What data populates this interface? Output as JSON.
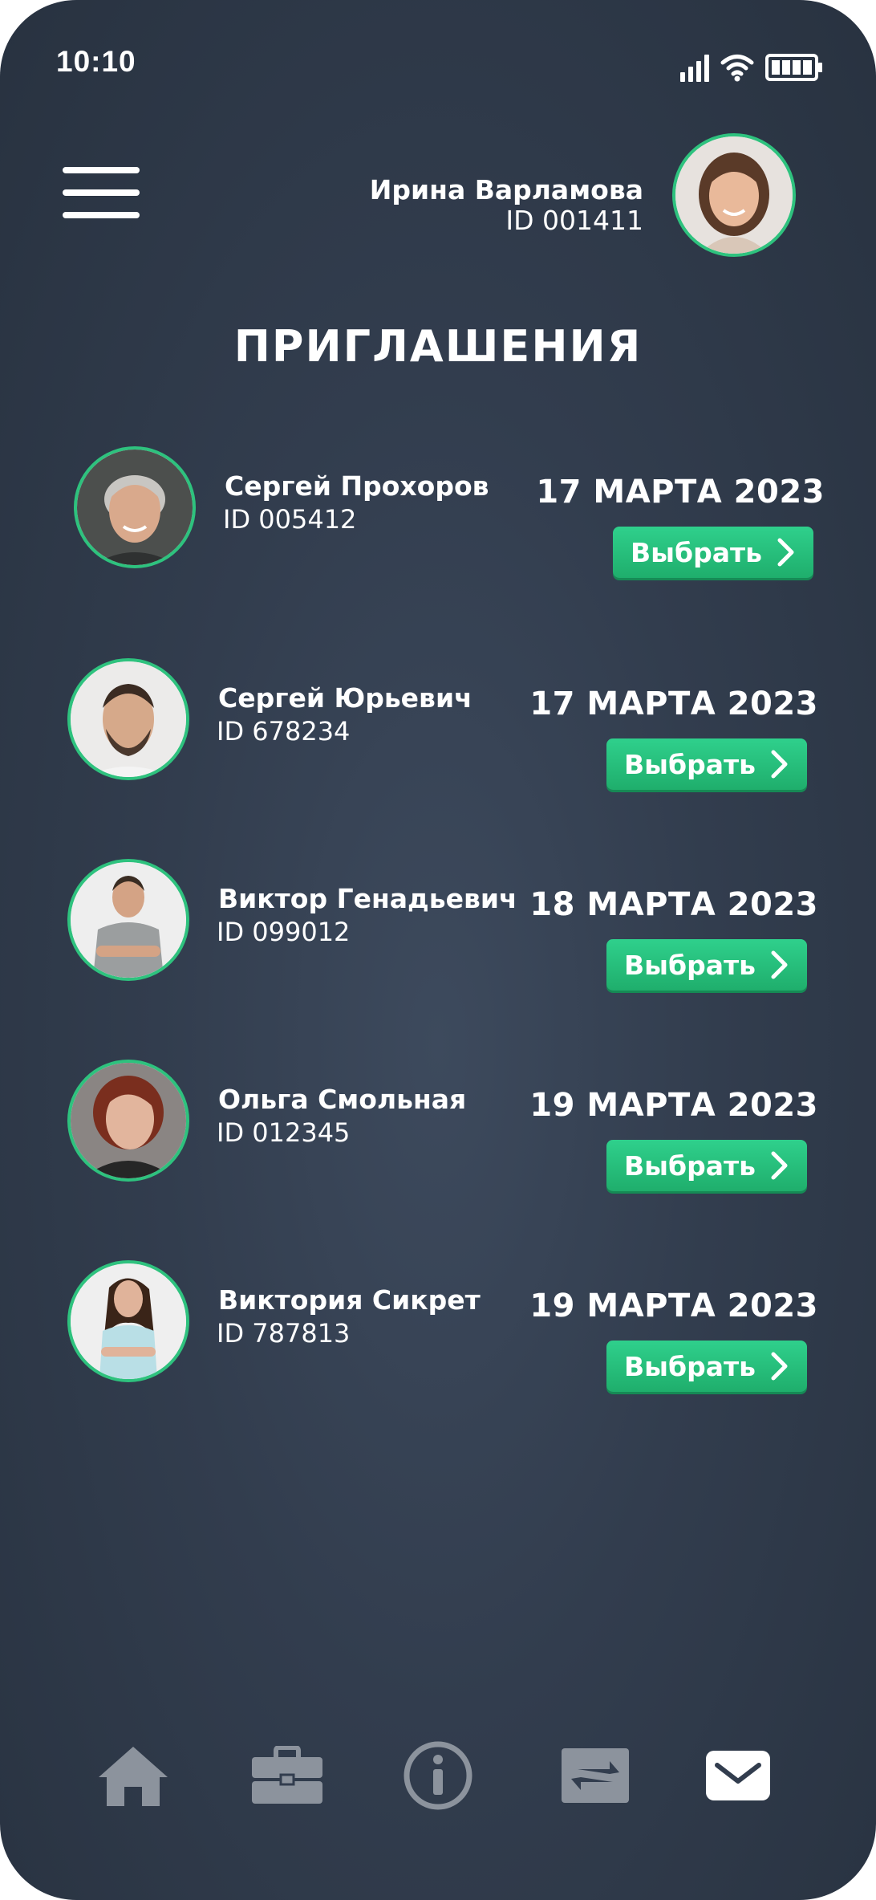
{
  "status_bar": {
    "time": "10:10"
  },
  "header": {
    "user_name": "Ирина Варламова",
    "user_id": "ID 001411"
  },
  "page_title": "ПРИГЛАШЕНИЯ",
  "invitations": [
    {
      "name": "Сергей Прохоров",
      "id": "ID 005412",
      "date": "17 МАРТА 2023",
      "action": "Выбрать"
    },
    {
      "name": "Сергей Юрьевич",
      "id": "ID 678234",
      "date": "17 МАРТА 2023",
      "action": "Выбрать"
    },
    {
      "name": "Виктор Генадьевич",
      "id": "ID 099012",
      "date": "18 МАРТА 2023",
      "action": "Выбрать"
    },
    {
      "name": "Ольга Смольная",
      "id": "ID 012345",
      "date": "19 МАРТА 2023",
      "action": "Выбрать"
    },
    {
      "name": "Виктория Сикрет",
      "id": "ID 787813",
      "date": "19 МАРТА 2023",
      "action": "Выбрать"
    }
  ],
  "bottom_nav": [
    {
      "icon": "home-icon",
      "active": false
    },
    {
      "icon": "briefcase-icon",
      "active": false
    },
    {
      "icon": "info-icon",
      "active": false
    },
    {
      "icon": "swap-icon",
      "active": false
    },
    {
      "icon": "mail-icon",
      "active": true
    }
  ],
  "colors": {
    "background": "#323d4e",
    "accent": "#2ec27e",
    "nav_inactive": "#8c939d",
    "nav_active": "#ffffff"
  }
}
